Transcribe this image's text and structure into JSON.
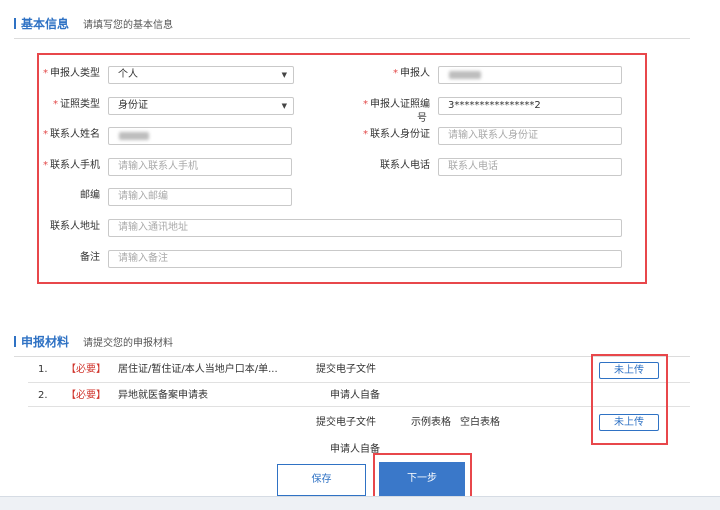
{
  "basic_info": {
    "title": "基本信息",
    "subtitle": "请填写您的基本信息"
  },
  "form": {
    "required_mark": "*",
    "applicant_type": {
      "label": "申报人类型",
      "value": "个人"
    },
    "applicant": {
      "label": "申报人"
    },
    "id_type": {
      "label": "证照类型",
      "value": "身份证"
    },
    "applicant_id_no": {
      "label_line1": "申报人证照编",
      "label_line2": "号",
      "value": "3****************2"
    },
    "contact_name": {
      "label": "联系人姓名"
    },
    "contact_id": {
      "label": "联系人身份证",
      "placeholder": "请输入联系人身份证"
    },
    "contact_mobile": {
      "label": "联系人手机",
      "placeholder": "请输入联系人手机"
    },
    "contact_phone": {
      "label": "联系人电话",
      "placeholder": "联系人电话"
    },
    "postcode": {
      "label": "邮编",
      "placeholder": "请输入邮编"
    },
    "address": {
      "label": "联系人地址",
      "placeholder": "请输入通讯地址"
    },
    "remark": {
      "label": "备注",
      "placeholder": "请输入备注"
    },
    "caret_icon": "caret-down-icon"
  },
  "materials": {
    "title": "申报材料",
    "subtitle": "请提交您的申报材料",
    "rows": [
      {
        "index": "1.",
        "tag": "【必要】",
        "name": "居住证/暂住证/本人当地户口本/单...",
        "submit_type": "提交电子文件",
        "source": "申请人自备",
        "upload": "未上传"
      },
      {
        "index": "2.",
        "tag": "【必要】",
        "name": "异地就医备案申请表",
        "submit_type": "提交电子文件",
        "source": "申请人自备",
        "sample": "示例表格",
        "blank": "空白表格",
        "upload": "未上传"
      }
    ]
  },
  "actions": {
    "save": "保存",
    "next": "下一步"
  }
}
